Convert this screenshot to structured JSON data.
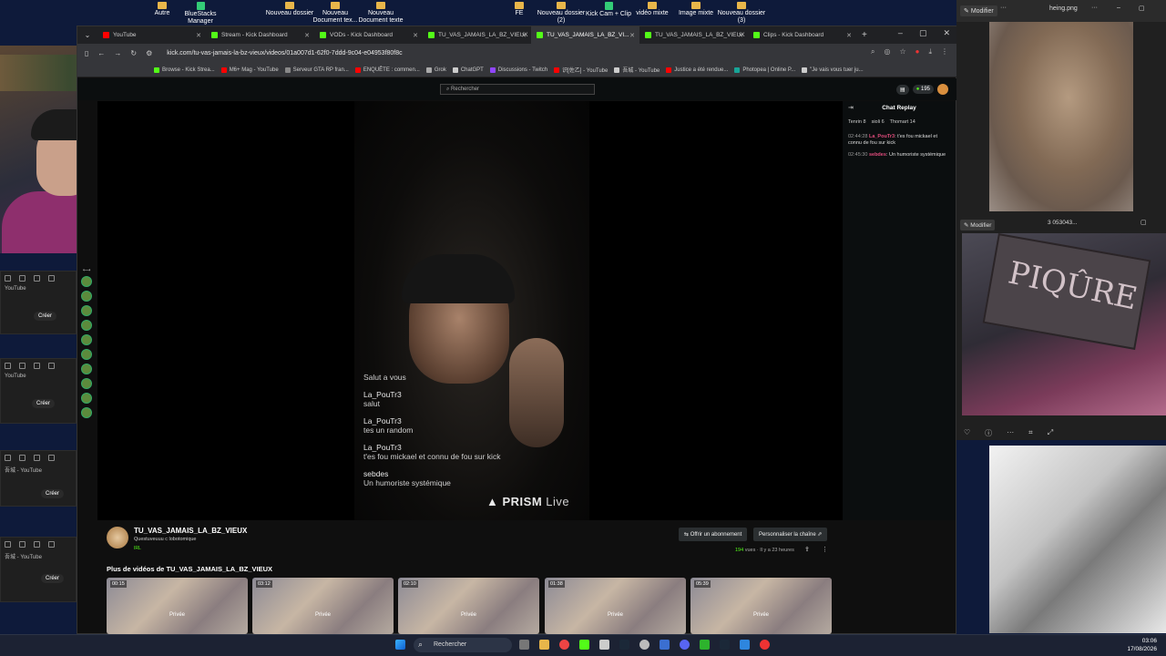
{
  "desktop_icons": [
    {
      "label": "Autre"
    },
    {
      "label": "BlueStacks\nManager"
    },
    {
      "label": "Nouveau dossier"
    },
    {
      "label": "Nouveau\nDocument tex..."
    },
    {
      "label": "Nouveau\nDocument texte"
    },
    {
      "label": "FE"
    },
    {
      "label": "Nouveau dossier\n(2)"
    },
    {
      "label": "Kick Cam + Clip"
    },
    {
      "label": "vidéo mixte"
    },
    {
      "label": "Image mixte"
    },
    {
      "label": "Nouveau dossier\n(3)"
    }
  ],
  "left_panels": {
    "youtube_label": "YouTube",
    "zh_youtube_label": "吾城 - YouTube",
    "create_label": "Créer"
  },
  "browser": {
    "tabs": [
      {
        "label": "YouTube",
        "color": "#ff0000"
      },
      {
        "label": "Stream - Kick Dashboard",
        "color": "#53fc18"
      },
      {
        "label": "VODs - Kick Dashboard",
        "color": "#53fc18"
      },
      {
        "label": "TU_VAS_JAMAIS_LA_BZ_VIEUX",
        "color": "#53fc18"
      },
      {
        "label": "TU_VAS_JAMAIS_LA_BZ_VI...",
        "color": "#53fc18",
        "active": true
      },
      {
        "label": "TU_VAS_JAMAIS_LA_BZ_VIEUX",
        "color": "#53fc18"
      },
      {
        "label": "Clips - Kick Dashboard",
        "color": "#53fc18"
      }
    ],
    "url": "kick.com/tu-vas-jamais-la-bz-vieux/videos/01a007d1-62f0-7ddd-9c04-e04953f80f8c",
    "bookmarks": [
      {
        "label": "Browse - Kick Strea...",
        "color": "#53fc18"
      },
      {
        "label": "M6+ Mag - YouTube",
        "color": "#ff0000"
      },
      {
        "label": "Serveur GTA RP fran...",
        "color": "#888888"
      },
      {
        "label": "ENQUÊTE : commen...",
        "color": "#ff0000"
      },
      {
        "label": "Grok",
        "color": "#aaaaaa"
      },
      {
        "label": "ChatGPT",
        "color": "#cccccc"
      },
      {
        "label": "Discussions - Twitch",
        "color": "#9146ff"
      },
      {
        "label": "识[佐乙] - YouTube",
        "color": "#ff0000"
      },
      {
        "label": "吾城 - YouTube",
        "color": "#cccccc"
      },
      {
        "label": "Justice a été rendue...",
        "color": "#ff0000"
      },
      {
        "label": "Photopea | Online P...",
        "color": "#18a497"
      },
      {
        "label": "\"Je vais vous tuer ju...",
        "color": "#cccccc"
      }
    ]
  },
  "kick": {
    "search_placeholder": "Rechercher",
    "viewer_count": "195",
    "video_overlay": [
      {
        "name": "",
        "msg": "Salut a vous"
      },
      {
        "name": "La_PouTr3",
        "msg": "salut"
      },
      {
        "name": "La_PouTr3",
        "msg": "tes un random"
      },
      {
        "name": "La_PouTr3",
        "msg": "t'es fou mickael et connu de fou sur kick"
      },
      {
        "name": "sebdes",
        "msg": "Un humoriste systémique"
      }
    ],
    "prism": {
      "brand": "PRISM",
      "suffix": "Live"
    },
    "chat": {
      "title": "Chat Replay",
      "top_gifters": [
        "Tenrin 8",
        "sioli 6",
        "Thomart 14"
      ],
      "lines": [
        {
          "time": "02:44:28",
          "user": "La_PouTr3",
          "text": "t'es fou mickael et connu de fou sur kick"
        },
        {
          "time": "02:45:30",
          "user": "sebdes",
          "text": "Un humoriste systémique"
        }
      ]
    },
    "channel": {
      "name": "TU_VAS_JAMAIS_LA_BZ_VIEUX",
      "subtitle": "Questuveuuu c lobotomique",
      "badge": "IRL",
      "subscribe_label": "Offrir un abonnement",
      "customize_label": "Personnaliser la chaîne",
      "views": "194",
      "views_suffix": "vues",
      "age": "Il y a 23 heures"
    },
    "more_videos_title": "Plus de vidéos de TU_VAS_JAMAIS_LA_BZ_VIEUX",
    "thumbs": [
      {
        "duration": "00:15",
        "label": "Privée"
      },
      {
        "duration": "03:12",
        "label": "Privée"
      },
      {
        "duration": "02:10",
        "label": "Privée"
      },
      {
        "duration": "01:38",
        "label": "Privée"
      },
      {
        "duration": "05:39",
        "label": "Privée"
      }
    ]
  },
  "right_panels": {
    "edit_label": "Modifier",
    "file1": "heing.png",
    "file2": "3 053043...",
    "sign_text": "PIQÛRE"
  },
  "taskbar": {
    "search_label": "Rechercher",
    "time": "03:06",
    "date": "17/08/2026"
  }
}
